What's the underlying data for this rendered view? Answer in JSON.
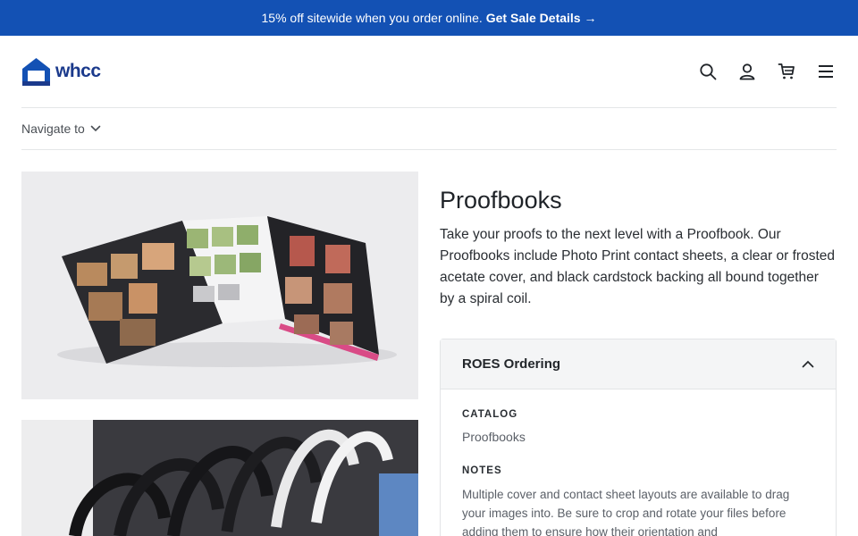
{
  "promo": {
    "text": "15% off sitewide when you order online.",
    "link_label": "Get Sale Details →"
  },
  "header": {
    "logo_text": "whcc",
    "icons": [
      "search-icon",
      "user-icon",
      "cart-icon",
      "menu-icon"
    ]
  },
  "subnav": {
    "label": "Navigate to"
  },
  "product": {
    "title": "Proofbooks",
    "description": "Take your proofs to the next level with a Proofbook. Our Proofbooks include Photo Print contact sheets, a clear or frosted acetate cover, and black cardstock backing all bound together by a spiral coil."
  },
  "accordion": {
    "title": "ROES Ordering",
    "catalog_label": "CATALOG",
    "catalog_value": "Proofbooks",
    "notes_label": "NOTES",
    "notes_text": "Multiple cover and contact sheet layouts are available to drag your images into. Be sure to crop and rotate your files before adding them to ensure how their orientation and"
  },
  "colors": {
    "promo_bg": "#1351b4",
    "brand": "#1b3a8c"
  }
}
